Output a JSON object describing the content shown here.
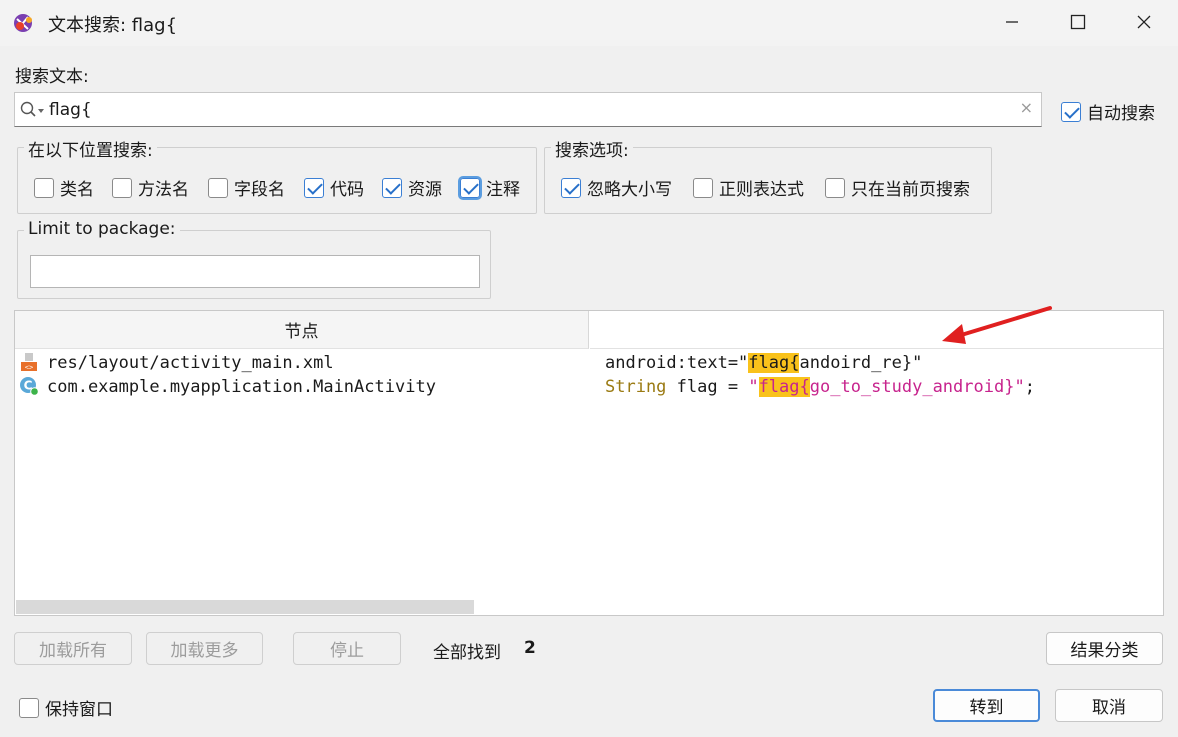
{
  "window": {
    "title": "文本搜索: flag{",
    "icon": "jadx-app-icon"
  },
  "search": {
    "label": "搜索文本:",
    "value": "flag{",
    "clear_icon": "×",
    "auto_search_label": "自动搜索",
    "auto_search_checked": true
  },
  "location": {
    "title": "在以下位置搜索:",
    "options": [
      {
        "label": "类名",
        "checked": false
      },
      {
        "label": "方法名",
        "checked": false
      },
      {
        "label": "字段名",
        "checked": false
      },
      {
        "label": "代码",
        "checked": true
      },
      {
        "label": "资源",
        "checked": true
      },
      {
        "label": "注释",
        "checked": true
      }
    ]
  },
  "search_options": {
    "title": "搜索选项:",
    "options": [
      {
        "label": "忽略大小写",
        "checked": true
      },
      {
        "label": "正则表达式",
        "checked": false
      },
      {
        "label": "只在当前页搜索",
        "checked": false
      }
    ]
  },
  "package": {
    "title": "Limit to package:",
    "value": ""
  },
  "results": {
    "header_node": "节点",
    "header_code": "",
    "rows": [
      {
        "icon": "xml-file-icon",
        "name": "res/layout/activity_main.xml",
        "code_pre": "android:text=\"",
        "code_hl": "flag{",
        "code_post": "andoird_re}\""
      },
      {
        "icon": "class-icon",
        "name": "com.example.myapplication.MainActivity",
        "code_kw": "String",
        "code_mid": " flag = ",
        "code_q1": "\"",
        "code_hl": "flag{",
        "code_str": "go_to_study_android}\"",
        "code_end": ";"
      }
    ]
  },
  "footer": {
    "load_all": "加载所有",
    "load_more": "加载更多",
    "stop": "停止",
    "found_label": "全部找到",
    "found_count": "2",
    "group_results": "结果分类",
    "keep_window": "保持窗口",
    "keep_window_checked": false,
    "goto": "转到",
    "cancel": "取消"
  },
  "colors": {
    "highlight": "#f9c21b",
    "accent": "#2870c9",
    "annotation_arrow": "#e02020"
  }
}
